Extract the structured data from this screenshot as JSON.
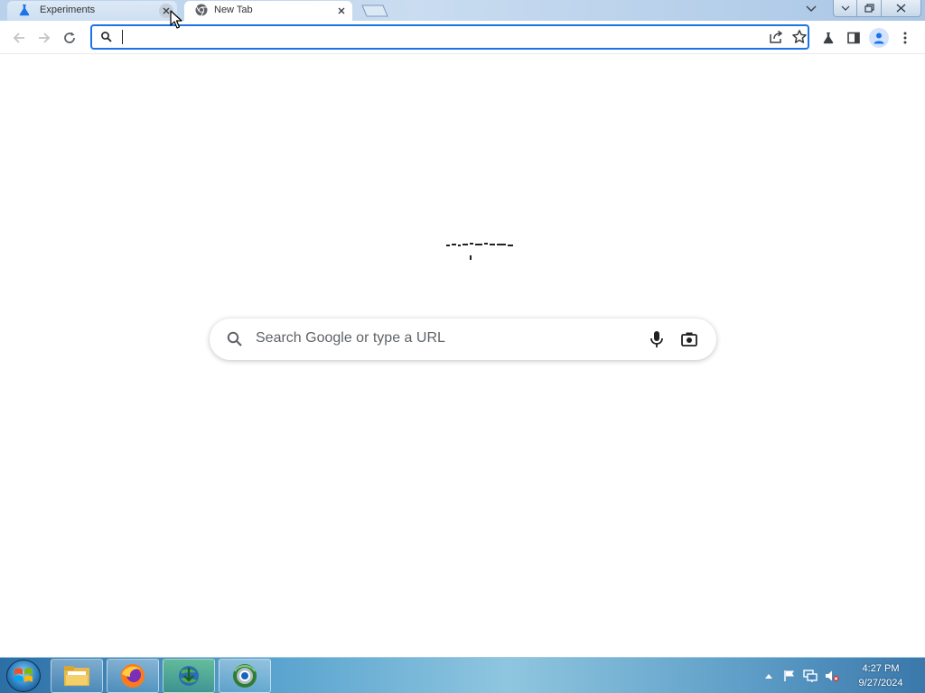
{
  "browser": {
    "tabs": [
      {
        "title": "Experiments",
        "icon": "beaker-icon",
        "active": false
      },
      {
        "title": "New Tab",
        "icon": "chrome-icon",
        "active": true
      }
    ],
    "omnibox": {
      "value": "",
      "placeholder": ""
    }
  },
  "new_tab_page": {
    "search_placeholder": "Search Google or type a URL"
  },
  "taskbar": {
    "apps": [
      "file-explorer-icon",
      "firefox-icon",
      "internet-download-manager-icon",
      "chrome-alt-icon"
    ],
    "tray_icons": [
      "show-hidden-icons-icon",
      "action-center-flag-icon",
      "network-icon",
      "volume-muted-icon"
    ],
    "clock": {
      "time": "4:27 PM",
      "date": "9/27/2024"
    }
  },
  "colors": {
    "accent": "#1a73e8",
    "tabstrip": "#c9dcf0",
    "taskbar": "#5aa4cf",
    "placeholder_text": "#5f6368"
  }
}
